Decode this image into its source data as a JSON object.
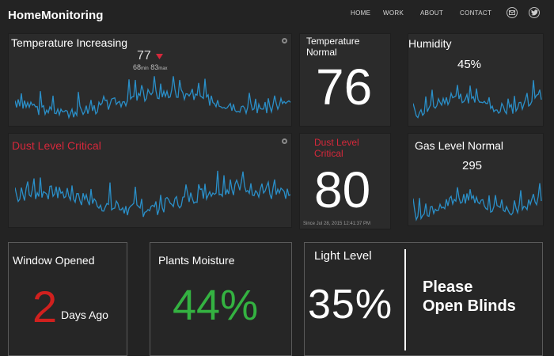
{
  "header": {
    "brand": "HomeMonitoring",
    "nav": [
      "HOME",
      "WORK",
      "ABOUT",
      "CONTACT"
    ],
    "icons": [
      "email-icon",
      "twitter-icon"
    ]
  },
  "colors": {
    "background": "#232323",
    "panel": "#2b2b2b",
    "sparkline": "#2a8fc8",
    "critical": "#d6283b",
    "good": "#34b241",
    "alert_number": "#d0201e"
  },
  "tiles": {
    "temperature_chart": {
      "title": "Temperature Increasing",
      "current": "77",
      "min": "68",
      "min_label": "min",
      "max": "83",
      "max_label": "max",
      "trend": "down-arrow-icon"
    },
    "temperature_value": {
      "title": "Temperature Normal",
      "value": "76"
    },
    "humidity": {
      "title": "Humidity",
      "value": "45%"
    },
    "dust_chart": {
      "title": "Dust Level Critical"
    },
    "dust_value": {
      "title": "Dust Level Critical",
      "value": "80",
      "since": "Since Jul 28, 2015 12:41:37 PM"
    },
    "gas": {
      "title": "Gas Level Normal",
      "value": "295"
    },
    "window": {
      "title": "Window Opened",
      "number": "2",
      "suffix": "Days Ago"
    },
    "plants": {
      "title": "Plants Moisture",
      "value": "44%"
    },
    "light": {
      "title": "Light Level",
      "value": "35%",
      "message_line1": "Please",
      "message_line2": "Open Blinds"
    }
  }
}
